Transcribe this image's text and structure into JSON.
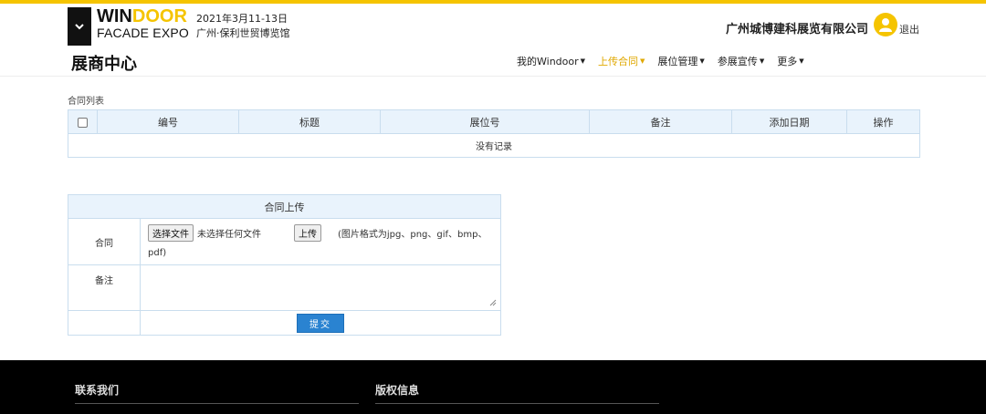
{
  "brand": {
    "win": "WIN",
    "door": "DOOR",
    "facade": "FACADE EXPO",
    "date": "2021年3月11-13日",
    "venue": "广州·保利世贸博览馆"
  },
  "header": {
    "company": "广州城博建科展览有限公司",
    "logout": "退出"
  },
  "nav": {
    "title": "展商中心",
    "items": [
      {
        "label": "我的Windoor"
      },
      {
        "label": "上传合同"
      },
      {
        "label": "展位管理"
      },
      {
        "label": "参展宣传"
      },
      {
        "label": "更多"
      }
    ]
  },
  "contract_list": {
    "label": "合同列表",
    "columns": [
      "编号",
      "标题",
      "展位号",
      "备注",
      "添加日期",
      "操作"
    ],
    "empty_text": "没有记录"
  },
  "upload": {
    "title": "合同上传",
    "contract_label": "合同",
    "choose_file": "选择文件",
    "no_file": "未选择任何文件",
    "upload_btn": "上传",
    "hint_line1": "(图片格式为jpg、png、gif、bmp、",
    "hint_line2": "pdf)",
    "remark_label": "备注",
    "submit": "提交"
  },
  "footer": {
    "contact": "联系我们",
    "copyright": "版权信息"
  },
  "colors": {
    "accent": "#f5c400",
    "active_nav": "#e0a800",
    "table_head": "#e9f3fc",
    "submit": "#2a83d1"
  }
}
